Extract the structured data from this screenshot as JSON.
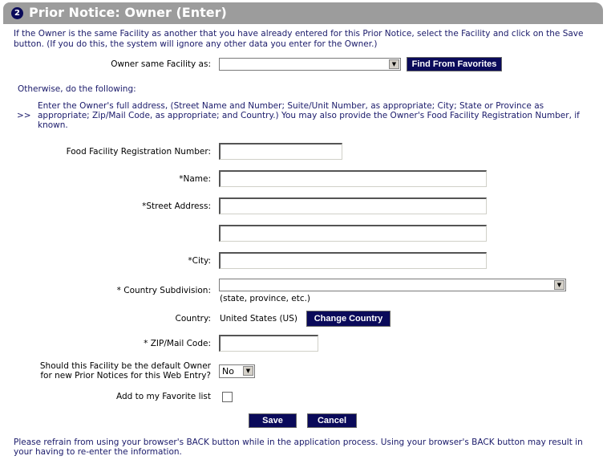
{
  "header": {
    "step_number": "2",
    "title": "Prior Notice: Owner (Enter)"
  },
  "intro_text": "If the Owner is the same Facility as another that you have already entered for this Prior Notice, select the Facility and click on the Save button. (If you do this, the system will ignore any other data you enter for the Owner.)",
  "same_facility": {
    "label": "Owner same Facility as:",
    "selected": "",
    "find_button": "Find From Favorites"
  },
  "otherwise_text": "Otherwise, do the following:",
  "instructions": {
    "marker": ">>",
    "text": "Enter the Owner's full address, (Street Name and Number; Suite/Unit Number, as appropriate; City; State or Province as appropriate; Zip/Mail Code, as appropriate; and Country.) You may also provide the Owner's Food Facility Registration Number, if known."
  },
  "form": {
    "ffrn_label": "Food Facility Registration Number:",
    "ffrn_value": "",
    "name_label": "*Name:",
    "name_value": "",
    "street_label": "*Street Address:",
    "street1_value": "",
    "street2_value": "",
    "city_label": "*City:",
    "city_value": "",
    "subdivision_label": "* Country Subdivision:",
    "subdivision_selected": "",
    "subdivision_note": "(state, province, etc.)",
    "country_label": "Country:",
    "country_value": "United States (US)",
    "change_country_button": "Change Country",
    "zip_label": "* ZIP/Mail Code:",
    "zip_value": "",
    "default_owner_label_line1": "Should this Facility be the default Owner",
    "default_owner_label_line2": "for new Prior Notices for this Web Entry?",
    "default_owner_selected": "No",
    "favorite_label": "Add to my Favorite list",
    "favorite_checked": false
  },
  "actions": {
    "save": "Save",
    "cancel": "Cancel"
  },
  "footer_text": "Please refrain from using your browser's BACK button while in the application process. Using your browser's BACK button may result in your having to re-enter the information."
}
